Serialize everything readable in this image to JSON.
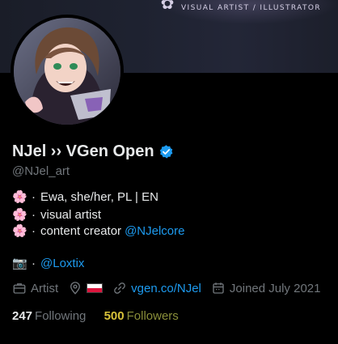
{
  "banner": {
    "tagline": "VISUAL ARTIST / ILLUSTRATOR"
  },
  "profile": {
    "display_name": "NJel ›› VGen Open",
    "handle": "@NJel_art",
    "verified": true
  },
  "bio": {
    "lines": [
      {
        "emoji": "🌸",
        "sep": "·",
        "text": "Ewa, she/her, PL | EN",
        "link": ""
      },
      {
        "emoji": "🌸",
        "sep": "·",
        "text": "visual artist",
        "link": ""
      },
      {
        "emoji": "🌸",
        "sep": "·",
        "text": "content creator",
        "link": "@NJelcore"
      },
      {
        "emoji": "📷",
        "sep": "·",
        "text": "",
        "link": "@Loxtix"
      }
    ]
  },
  "meta": {
    "category": "Artist",
    "location_flag": "Poland flag",
    "website": "vgen.co/NJel",
    "joined": "Joined July 2021"
  },
  "stats": {
    "following_count": "247",
    "following_label": "Following",
    "followers_count": "500",
    "followers_label": "Followers"
  },
  "colors": {
    "background": "#000000",
    "link": "#1d9bf0",
    "muted": "#71767b",
    "text": "#e7e9ea",
    "verified": "#1d9bf0",
    "followers_highlight": "#d9c33a"
  }
}
